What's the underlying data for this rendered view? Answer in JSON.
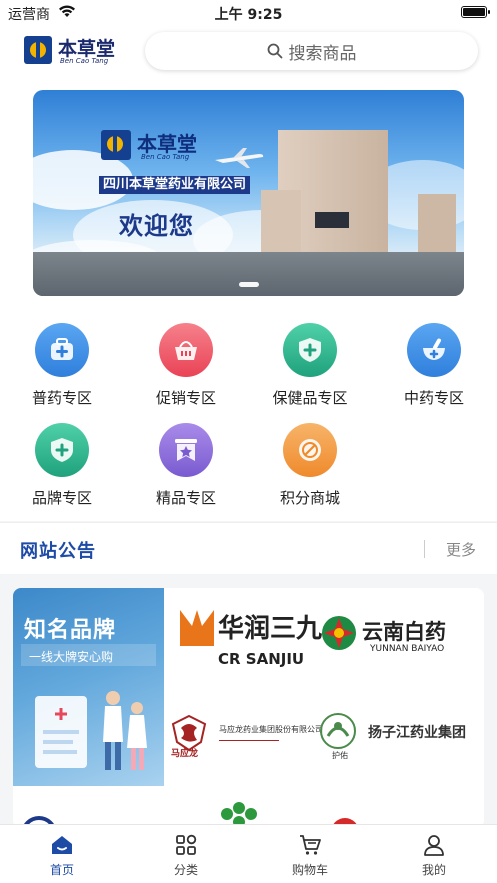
{
  "status_bar": {
    "carrier": "运营商",
    "time": "上午 9:25"
  },
  "header": {
    "logo_text": "本草堂",
    "logo_sub": "Ben Cao Tang",
    "search_placeholder": "搜索商品",
    "search_icon": "search-icon"
  },
  "banner": {
    "logo_text": "本草堂",
    "logo_sub": "Ben Cao Tang",
    "company": "四川本草堂药业有限公司",
    "welcome": "欢迎您",
    "slide_count": 1,
    "active_slide": 1
  },
  "categories": [
    {
      "label": "普药专区",
      "icon": "medicine-box-icon",
      "color": "#3b8fe6"
    },
    {
      "label": "促销专区",
      "icon": "shopping-basket-icon",
      "color": "#ef5b6a"
    },
    {
      "label": "保健品专区",
      "icon": "health-shield-icon",
      "color": "#2fb58f"
    },
    {
      "label": "中药专区",
      "icon": "mortar-icon",
      "color": "#3b8fe6"
    },
    {
      "label": "品牌专区",
      "icon": "brand-shield-icon",
      "color": "#2fb58f"
    },
    {
      "label": "精品专区",
      "icon": "star-bookmark-icon",
      "color": "#8c6fd6"
    },
    {
      "label": "积分商城",
      "icon": "points-coin-icon",
      "color": "#f39a3e"
    }
  ],
  "notice": {
    "title": "网站公告",
    "more": "更多"
  },
  "brands": {
    "promo_title": "知名品牌",
    "promo_subtitle": "一线大牌安心购",
    "logos": [
      {
        "name": "华润三九",
        "sub": "CR SANJIU"
      },
      {
        "name": "云南白药",
        "sub": "YUNNAN BAIYAO"
      },
      {
        "name": "马应龙",
        "sub": "马应龙药业集团股份有限公司"
      },
      {
        "name": "扬子江药业集团",
        "sub": "护佑"
      }
    ]
  },
  "tabbar": {
    "tabs": [
      {
        "label": "首页",
        "icon": "home-icon",
        "active": true
      },
      {
        "label": "分类",
        "icon": "category-grid-icon",
        "active": false
      },
      {
        "label": "购物车",
        "icon": "cart-icon",
        "active": false
      },
      {
        "label": "我的",
        "icon": "user-icon",
        "active": false
      }
    ]
  },
  "colors": {
    "accent": "#1d4ba6",
    "brand_navy": "#14408f",
    "brand_gold": "#f3b400"
  }
}
